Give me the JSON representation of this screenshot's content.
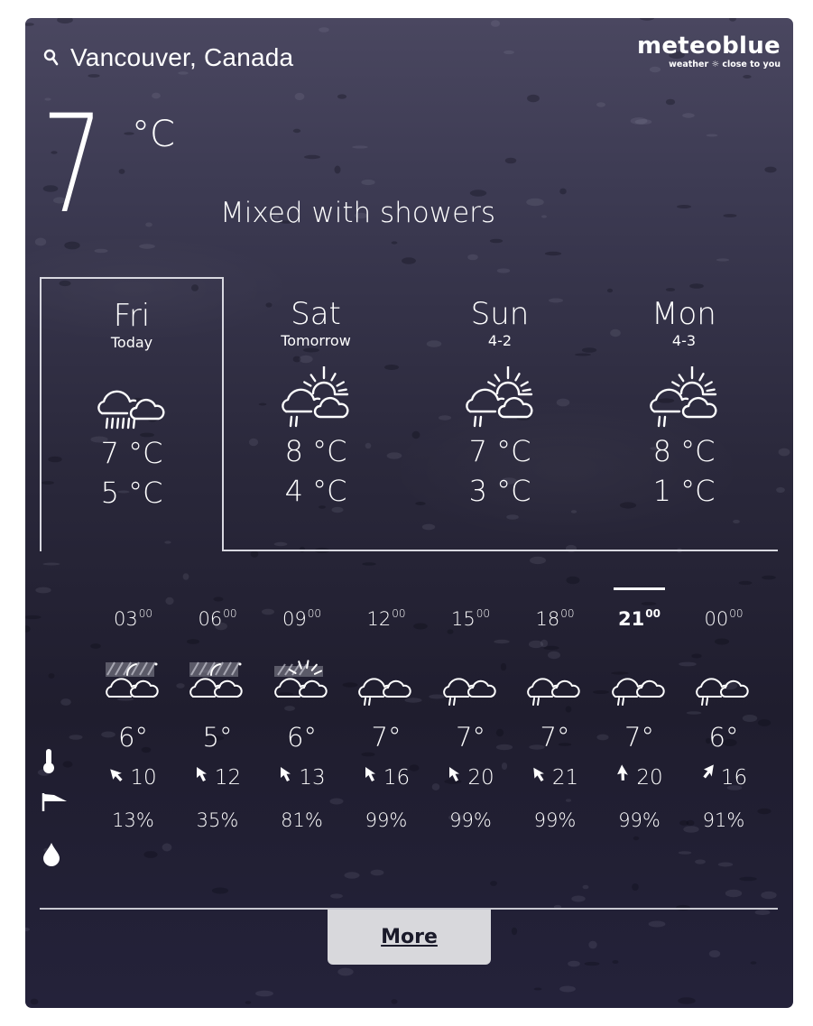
{
  "header": {
    "location": "Vancouver, Canada",
    "logo_main": "meteoblue",
    "logo_sub": "weather ☼ close to you"
  },
  "current": {
    "temperature": "7",
    "unit": "°C",
    "description": "Mixed with showers"
  },
  "days": [
    {
      "name": "Fri",
      "sub": "Today",
      "icon": "cloud-rain-heavy-icon",
      "high": "7 °C",
      "low": "5 °C",
      "active": true
    },
    {
      "name": "Sat",
      "sub": "Tomorrow",
      "icon": "sun-cloud-rain-icon",
      "high": "8 °C",
      "low": "4 °C",
      "active": false
    },
    {
      "name": "Sun",
      "sub": "4-2",
      "icon": "sun-cloud-rain-icon",
      "high": "7 °C",
      "low": "3 °C",
      "active": false
    },
    {
      "name": "Mon",
      "sub": "4-3",
      "icon": "sun-cloud-rain-icon",
      "high": "8 °C",
      "low": "1 °C",
      "active": false
    }
  ],
  "hourly": [
    {
      "hour": "03",
      "min": "00",
      "icon": "night-fog-cloud-icon",
      "temp": "6°",
      "wind_speed": "10",
      "wind_dir_deg": 300,
      "precip": "13%",
      "active": false
    },
    {
      "hour": "06",
      "min": "00",
      "icon": "night-fog-cloud-icon",
      "temp": "5°",
      "wind_speed": "12",
      "wind_dir_deg": 315,
      "precip": "35%",
      "active": false
    },
    {
      "hour": "09",
      "min": "00",
      "icon": "sun-fog-cloud-icon",
      "temp": "6°",
      "wind_speed": "13",
      "wind_dir_deg": 315,
      "precip": "81%",
      "active": false
    },
    {
      "hour": "12",
      "min": "00",
      "icon": "cloud-rain-icon",
      "temp": "7°",
      "wind_speed": "16",
      "wind_dir_deg": 315,
      "precip": "99%",
      "active": false
    },
    {
      "hour": "15",
      "min": "00",
      "icon": "cloud-rain-icon",
      "temp": "7°",
      "wind_speed": "20",
      "wind_dir_deg": 315,
      "precip": "99%",
      "active": false
    },
    {
      "hour": "18",
      "min": "00",
      "icon": "cloud-rain-icon",
      "temp": "7°",
      "wind_speed": "21",
      "wind_dir_deg": 310,
      "precip": "99%",
      "active": false
    },
    {
      "hour": "21",
      "min": "00",
      "icon": "cloud-rain-icon",
      "temp": "7°",
      "wind_speed": "20",
      "wind_dir_deg": 340,
      "precip": "99%",
      "active": true
    },
    {
      "hour": "00",
      "min": "00",
      "icon": "cloud-rain-icon",
      "temp": "6°",
      "wind_speed": "16",
      "wind_dir_deg": 20,
      "precip": "91%",
      "active": false
    }
  ],
  "row_icons": {
    "temperature": "thermometer-icon",
    "wind": "wind-flag-icon",
    "precipitation": "raindrop-icon"
  },
  "more_button": {
    "label": "More"
  },
  "colors": {
    "background_top": "#4a4760",
    "background_bottom": "#1f1d2e",
    "text": "#ffffff",
    "button_bg": "#d8d8dc",
    "button_text": "#1a1a2a"
  }
}
